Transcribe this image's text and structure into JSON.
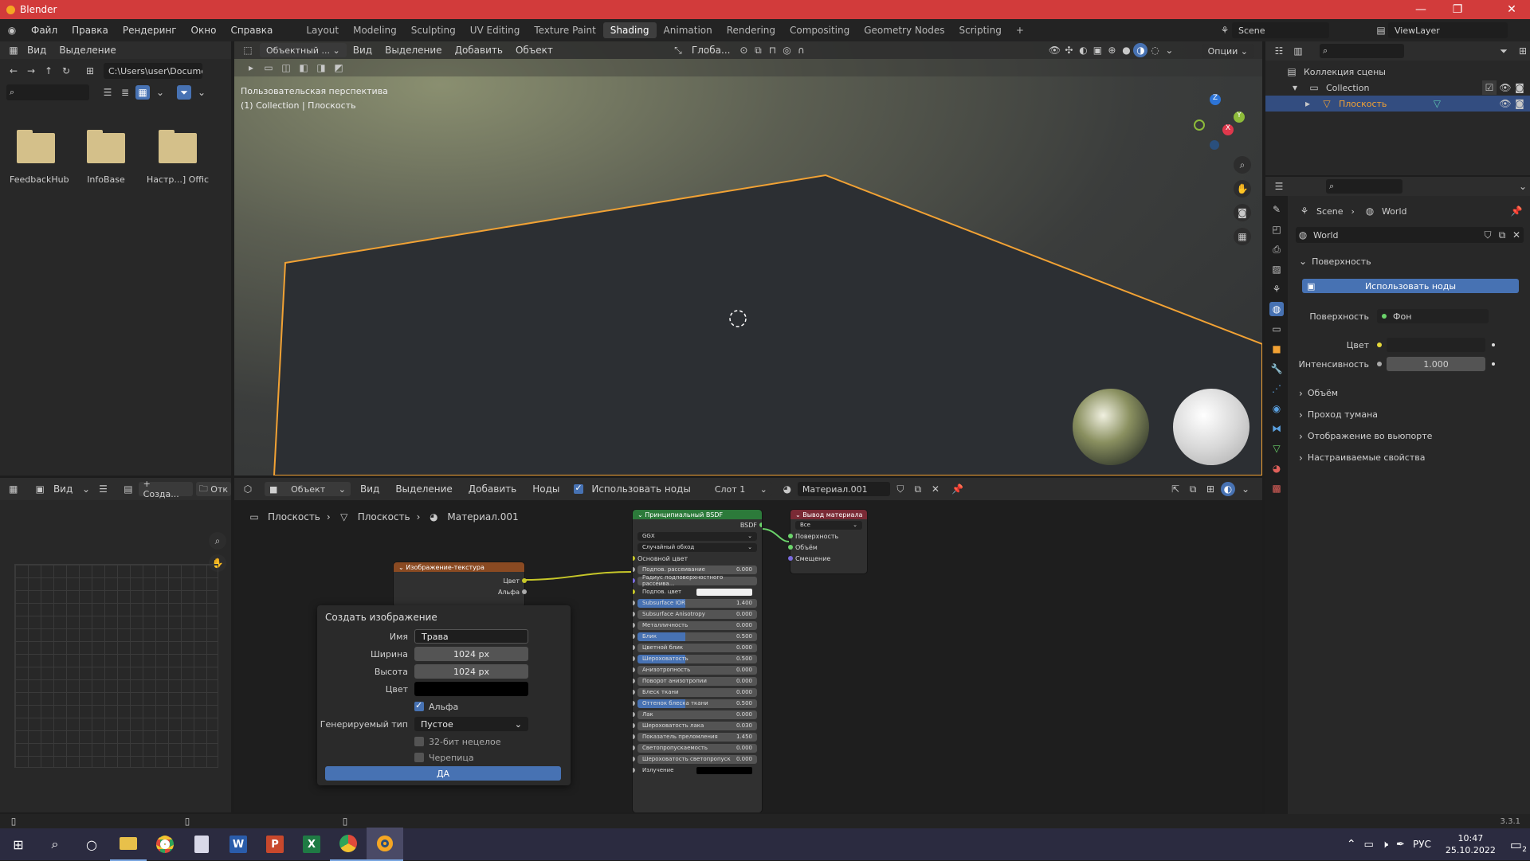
{
  "titlebar": {
    "title": "Blender"
  },
  "menus": [
    "Файл",
    "Правка",
    "Рендеринг",
    "Окно",
    "Справка"
  ],
  "workspaces": [
    "Layout",
    "Modeling",
    "Sculpting",
    "UV Editing",
    "Texture Paint",
    "Shading",
    "Animation",
    "Rendering",
    "Compositing",
    "Geometry Nodes",
    "Scripting"
  ],
  "active_workspace": "Shading",
  "scene": {
    "name": "Scene",
    "view_layer": "ViewLayer"
  },
  "file_browser": {
    "menus": [
      "Вид",
      "Выделение"
    ],
    "path": "C:\\Users\\user\\Docume...",
    "folders": [
      "FeedbackHub",
      "InfoBase",
      "Настр...] Offic"
    ]
  },
  "viewport": {
    "mode": "Объектный ...",
    "menus": [
      "Вид",
      "Выделение",
      "Добавить",
      "Объект"
    ],
    "transform": "Глоба...",
    "options": "Опции",
    "overlay_line1": "Пользовательская перспектива",
    "overlay_line2": "(1) Collection | Плоскость"
  },
  "outliner": {
    "scene_collection": "Коллекция сцены",
    "collection": "Collection",
    "object": "Плоскость"
  },
  "properties": {
    "breadcrumb_scene": "Scene",
    "breadcrumb_world": "World",
    "world_name": "World",
    "surface_panel": "Поверхность",
    "use_nodes": "Использовать ноды",
    "surface_label": "Поверхность",
    "surface_value": "Фон",
    "color_label": "Цвет",
    "intensity_label": "Интенсивность",
    "intensity_value": "1.000",
    "collapsed_panels": [
      "Объём",
      "Проход тумана",
      "Отображение во вьюпорте",
      "Настраиваемые свойства"
    ]
  },
  "image_editor": {
    "view": "Вид",
    "new_btn": "+ Созда...",
    "open_btn": "Отк"
  },
  "node_editor": {
    "object_mode": "Объект",
    "menus": [
      "Вид",
      "Выделение",
      "Добавить",
      "Ноды"
    ],
    "use_nodes": "Использовать ноды",
    "slot": "Слот 1",
    "material": "Материал.001",
    "breadcrumb": [
      "Плоскость",
      "Плоскость",
      "Материал.001"
    ]
  },
  "image_texture_node": {
    "title": "Изображение-текстура",
    "outputs": [
      "Цвет",
      "Альфа"
    ]
  },
  "bsdf_node": {
    "title": "Принципиальный BSDF",
    "output": "BSDF",
    "distribution": "GGX",
    "subsurface_method": "Случайный обход",
    "base_color": "Основной цвет",
    "rows": [
      {
        "label": "Подпов. рассеивание",
        "value": "0.000",
        "fill": 0
      },
      {
        "label": "Радиус подповерхностного рассеива...",
        "value": "",
        "fill": 0
      },
      {
        "label": "Подпов. цвет",
        "value": "",
        "fill": 0
      },
      {
        "label": "Subsurface IOR",
        "value": "1.400",
        "fill": 1
      },
      {
        "label": "Subsurface Anisotropy",
        "value": "0.000",
        "fill": 0
      },
      {
        "label": "Металличность",
        "value": "0.000",
        "fill": 0
      },
      {
        "label": "Блик",
        "value": "0.500",
        "fill": 1
      },
      {
        "label": "Цветной блик",
        "value": "0.000",
        "fill": 0
      },
      {
        "label": "Шероховатость",
        "value": "0.500",
        "fill": 1
      },
      {
        "label": "Анизотропность",
        "value": "0.000",
        "fill": 0
      },
      {
        "label": "Поворот анизотропии",
        "value": "0.000",
        "fill": 0
      },
      {
        "label": "Блеск ткани",
        "value": "0.000",
        "fill": 0
      },
      {
        "label": "Оттенок блеска ткани",
        "value": "0.500",
        "fill": 1
      },
      {
        "label": "Лак",
        "value": "0.000",
        "fill": 0
      },
      {
        "label": "Шероховатость лака",
        "value": "0.030",
        "fill": 0
      },
      {
        "label": "Показатель преломления",
        "value": "1.450",
        "fill": 0
      },
      {
        "label": "Светопропускаемость",
        "value": "0.000",
        "fill": 0
      },
      {
        "label": "Шероховатость светопропуск",
        "value": "0.000",
        "fill": 0
      },
      {
        "label": "Излучение",
        "value": "",
        "fill": 0
      }
    ]
  },
  "output_node": {
    "title": "Вывод материала",
    "target": "Все",
    "inputs": [
      "Поверхность",
      "Объём",
      "Смещение"
    ]
  },
  "dialog": {
    "title": "Создать изображение",
    "name_label": "Имя",
    "name_value": "Трава",
    "width_label": "Ширина",
    "width_value": "1024 px",
    "height_label": "Высота",
    "height_value": "1024 px",
    "color_label": "Цвет",
    "alpha_label": "Альфа",
    "gen_label": "Генерируемый тип",
    "gen_value": "Пустое",
    "float_label": "32-бит нецелое",
    "tiled_label": "Черепица",
    "ok": "ДА"
  },
  "status": {
    "version": "3.3.1"
  },
  "taskbar": {
    "lang": "РУС",
    "time": "10:47",
    "date": "25.10.2022",
    "notifications": "2"
  }
}
